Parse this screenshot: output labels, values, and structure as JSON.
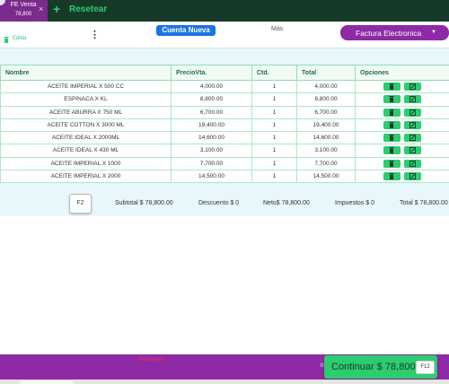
{
  "tab": {
    "title": "FE Venta",
    "amount": "78,800",
    "close_icon": "×"
  },
  "toolbar": {
    "add_icon": "+",
    "reset_label": "Resetear"
  },
  "header": {
    "edit_label": "Editar",
    "menu_icon": "⋮",
    "new_account_label": "Cuenta Nueva",
    "more_label": "Más",
    "invoice_type_label": "Factura Electronica",
    "invoice_caret": "▼"
  },
  "table": {
    "headers": [
      "Nombre",
      "PrecioVta.",
      "Ctd.",
      "Total",
      "Opciones"
    ],
    "rows": [
      {
        "name": "ACEITE IMPERIAL X 500 CC",
        "price": "4,000.00",
        "qty": "1",
        "total": "4,000.00"
      },
      {
        "name": "ESPINACA X KL",
        "price": "8,800.00",
        "qty": "1",
        "total": "8,800.00"
      },
      {
        "name": "ACEITE ABURRA X 750 ML",
        "price": "6,700.00",
        "qty": "1",
        "total": "6,700.00"
      },
      {
        "name": "ACEITE COTTON X 3000 ML",
        "price": "19,400.00",
        "qty": "1",
        "total": "19,400.00"
      },
      {
        "name": "ACEITE IDEAL X 2000ML",
        "price": "14,600.00",
        "qty": "1",
        "total": "14,600.00"
      },
      {
        "name": "ACEITE IDEAL X 430 ML",
        "price": "3,100.00",
        "qty": "1",
        "total": "3,100.00"
      },
      {
        "name": "ACEITE IMPERIAL X 1000",
        "price": "7,700.00",
        "qty": "1",
        "total": "7,700.00"
      },
      {
        "name": "ACEITE IMPERIAL X 2000",
        "price": "14,500.00",
        "qty": "1",
        "total": "14,500.00"
      }
    ]
  },
  "summary": {
    "shortcut": "F2",
    "subtotal": "Subtotal $ 78,800.00",
    "discount": "Descuento $ 0",
    "net": "Neto$ 78,800.00",
    "taxes": "Impuestos $ 0",
    "total": "Total $ 78,800.00"
  },
  "footer": {
    "red_label": "Descuento",
    "zero_label": "0",
    "continue_label": "Continuar $ 78,800",
    "continue_shortcut": "F12"
  },
  "colors": {
    "top_bar": "#173a28",
    "purple": "#8e2aa5",
    "green": "#2ecc71",
    "blue": "#1a73e8",
    "panel": "#e8f7fb"
  }
}
